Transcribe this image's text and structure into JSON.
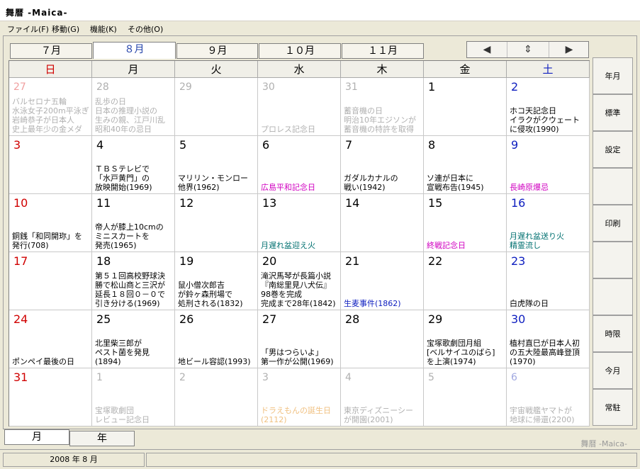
{
  "window": {
    "title": "舞暦 -Maica-"
  },
  "menu": [
    "ファイル(F)",
    "移動(G)",
    "機能(K)",
    "その他(O)"
  ],
  "month_tabs": [
    "７月",
    "８月",
    "９月",
    "１０月",
    "１１月"
  ],
  "nav": {
    "prev": "◀",
    "updown": "⇕",
    "next": "▶"
  },
  "weekdays": [
    "日",
    "月",
    "火",
    "水",
    "木",
    "金",
    "土"
  ],
  "colors": {
    "sunday": "#d00000",
    "saturday": "#1020c0",
    "other_month": "#b0b0b0",
    "purple": "#9090d0",
    "magenta": "#d000c0",
    "teal": "#007070",
    "green": "#008000"
  },
  "weeks": [
    [
      {
        "day": "27",
        "other": true,
        "numcolor": "#f0a0a0",
        "event": "バルセロナ五輪\n水泳女子200m平泳ぎ\n岩崎恭子が日本人\n史上最年少の金メダ",
        "evcolor": "#b0b0b0"
      },
      {
        "day": "28",
        "other": true,
        "event": "乱歩の日\n日本の推理小説の\n生みの親、江戸川乱\n昭和40年の忌日",
        "evcolor": "#b0b0b0"
      },
      {
        "day": "29",
        "other": true,
        "event": ""
      },
      {
        "day": "30",
        "other": true,
        "event": "プロレス記念日",
        "evcolor": "#b0b0b0"
      },
      {
        "day": "31",
        "other": true,
        "event": "蓄音機の日\n明治10年エジソンが\n蓄音機の特許を取得",
        "evcolor": "#b0b0b0"
      },
      {
        "day": "1",
        "event": ""
      },
      {
        "day": "2",
        "event": "ホコ天記念日\nイラクがクウェート\nに侵攻(1990)"
      }
    ],
    [
      {
        "day": "3",
        "event": ""
      },
      {
        "day": "4",
        "event": "ＴＢＳテレビで\n「水戸黄門」の\n放映開始(1969)"
      },
      {
        "day": "5",
        "event": "マリリン・モンロー\n他界(1962)"
      },
      {
        "day": "6",
        "event": "広島平和記念日",
        "evcolor": "#d000c0"
      },
      {
        "day": "7",
        "event": "ガダルカナルの\n戦い(1942)"
      },
      {
        "day": "8",
        "event": "ソ連が日本に\n宣戦布告(1945)"
      },
      {
        "day": "9",
        "event": "長崎原爆忌",
        "evcolor": "#d000c0"
      }
    ],
    [
      {
        "day": "10",
        "event": "銅銭「和同開珎」を\n発行(708)"
      },
      {
        "day": "11",
        "event": "帝人が膝上10cmの\nミニスカートを\n発売(1965)"
      },
      {
        "day": "12",
        "event": ""
      },
      {
        "day": "13",
        "event": "月遅れ盆迎え火",
        "evcolor": "#007070"
      },
      {
        "day": "14",
        "event": ""
      },
      {
        "day": "15",
        "event": "終戦記念日",
        "evcolor": "#d000c0"
      },
      {
        "day": "16",
        "event": "月遅れ盆送り火\n精霊流し",
        "evcolor": "#007070"
      }
    ],
    [
      {
        "day": "17",
        "event": ""
      },
      {
        "day": "18",
        "event": "第５１回高校野球決\n勝で松山商と三沢が\n延長１８回０－０で\n引き分ける(1969)"
      },
      {
        "day": "19",
        "event": "鼠小僧次郎吉\nが鈴ヶ森刑場で\n処刑される(1832)"
      },
      {
        "day": "20",
        "event": "滝沢馬琴が長篇小説\n『南総里見八犬伝』\n98巻を完成\n完成まで28年(1842)"
      },
      {
        "day": "21",
        "event": "生麦事件(1862)",
        "evcolor": "#1020c0"
      },
      {
        "day": "22",
        "event": ""
      },
      {
        "day": "23",
        "event": "白虎隊の日"
      }
    ],
    [
      {
        "day": "24",
        "event": "ポンペイ最後の日"
      },
      {
        "day": "25",
        "event": "北里柴三郎が\nペスト菌を発見\n(1894)"
      },
      {
        "day": "26",
        "event": "地ビール容認(1993)"
      },
      {
        "day": "27",
        "event": "「男はつらいよ」\n第一作が公開(1969)"
      },
      {
        "day": "28",
        "event": ""
      },
      {
        "day": "29",
        "event": "宝塚歌劇団月組\n[ベルサイユのばら]\nを上演(1974)"
      },
      {
        "day": "30",
        "event": "植村直巳が日本人初\nの五大陸最高峰登頂\n(1970)"
      }
    ],
    [
      {
        "day": "31",
        "event": ""
      },
      {
        "day": "1",
        "other": true,
        "event": "宝塚歌劇団\nレビュー記念日",
        "evcolor": "#b0b0b0"
      },
      {
        "day": "2",
        "other": true,
        "event": ""
      },
      {
        "day": "3",
        "other": true,
        "event": "ドラえもんの誕生日\n(2112)",
        "evcolor": "#f0c080"
      },
      {
        "day": "4",
        "other": true,
        "event": "東京ディズニーシー\nが開園(2001)",
        "evcolor": "#b0b0b0"
      },
      {
        "day": "5",
        "other": true,
        "event": ""
      },
      {
        "day": "6",
        "other": true,
        "numcolor": "#a0a8e0",
        "event": "宇宙戦艦ヤマトが\n地球に帰還(2200)",
        "evcolor": "#b0b0b0"
      }
    ]
  ],
  "sidebar": [
    "年月",
    "標準",
    "設定",
    "",
    "印刷",
    "",
    "",
    "時限",
    "今月",
    "常駐"
  ],
  "bottom_tabs": [
    "月",
    "年"
  ],
  "watermark": "舞暦 -Maica-",
  "status": {
    "date": "2008 年 8 月"
  }
}
